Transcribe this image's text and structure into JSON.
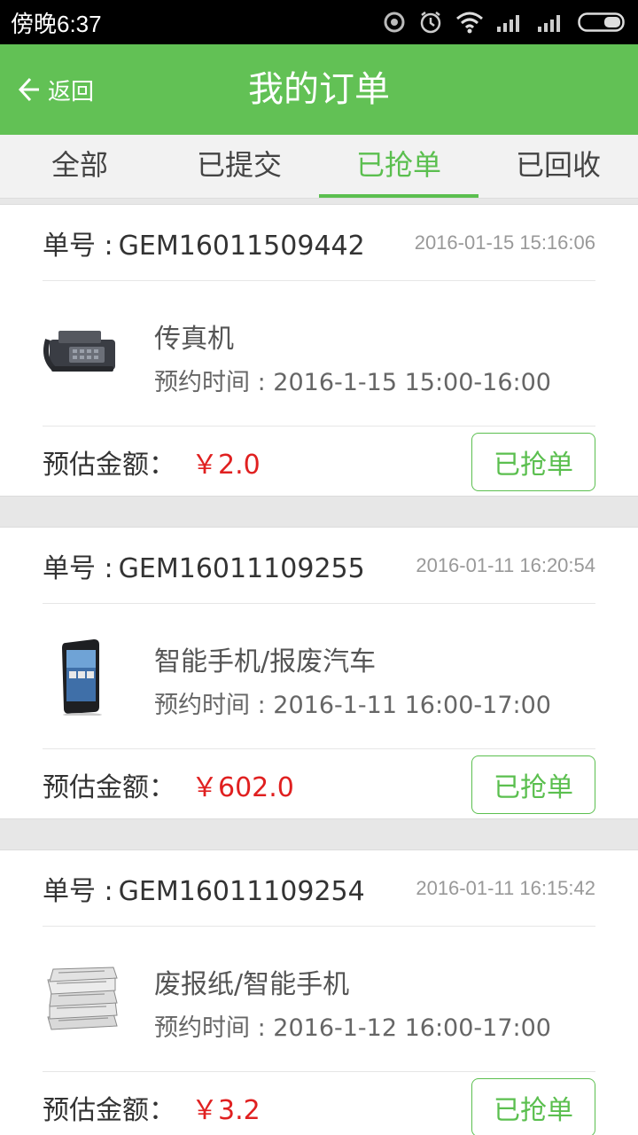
{
  "status_bar": {
    "time": "傍晚6:37"
  },
  "header": {
    "back_label": "返回",
    "title": "我的订单"
  },
  "tabs": [
    {
      "label": "全部",
      "active": false
    },
    {
      "label": "已提交",
      "active": false
    },
    {
      "label": "已抢单",
      "active": true
    },
    {
      "label": "已回收",
      "active": false
    }
  ],
  "orders": [
    {
      "no_label": "单号 :",
      "no": "GEM16011509442",
      "time": "2016-01-15  15:16:06",
      "item_name": "传真机",
      "appt_label": "预约时间 :",
      "appt": "2016-1-15  15:00-16:00",
      "est_label": "预估金额：",
      "price": "￥2.0",
      "button": "已抢单",
      "image": "fax-machine-image"
    },
    {
      "no_label": "单号 :",
      "no": "GEM16011109255",
      "time": "2016-01-11  16:20:54",
      "item_name": "智能手机/报废汽车",
      "appt_label": "预约时间 :",
      "appt": "2016-1-11  16:00-17:00",
      "est_label": "预估金额：",
      "price": "￥602.0",
      "button": "已抢单",
      "image": "smartphone-image"
    },
    {
      "no_label": "单号 :",
      "no": "GEM16011109254",
      "time": "2016-01-11  16:15:42",
      "item_name": "废报纸/智能手机",
      "appt_label": "预约时间 :",
      "appt": "2016-1-12  16:00-17:00",
      "est_label": "预估金额：",
      "price": "￥3.2",
      "button": "已抢单",
      "image": "newspaper-stack-image"
    }
  ],
  "colors": {
    "brand_green": "#62c155",
    "price_red": "#e02020"
  }
}
